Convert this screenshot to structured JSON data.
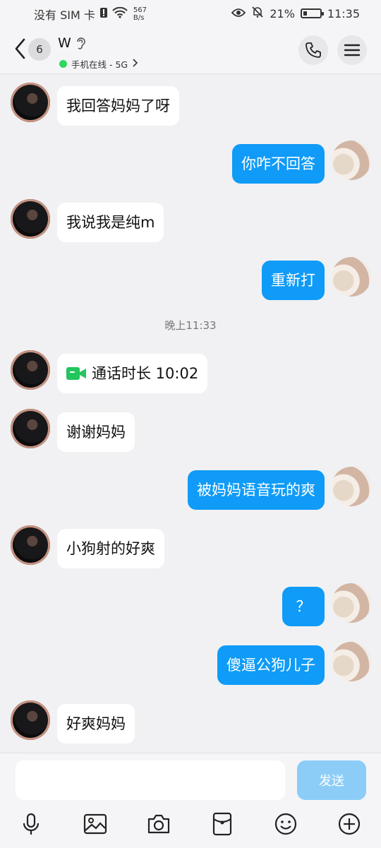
{
  "status": {
    "carrier": "没有 SIM 卡",
    "net_speed_value": "567",
    "net_speed_unit": "B/s",
    "battery": "21%",
    "battery_level": 0.21,
    "time": "11:35"
  },
  "header": {
    "unread_count": "6",
    "contact_name": "W",
    "online_status": "手机在线 - 5G",
    "icons": [
      "back-chevron-icon",
      "ear-icon",
      "phone-icon",
      "menu-icon"
    ]
  },
  "chat": {
    "messages": [
      {
        "side": "in",
        "text": "我回答妈妈了呀"
      },
      {
        "side": "out",
        "text": "你咋不回答"
      },
      {
        "side": "in",
        "text": "我说我是纯m"
      },
      {
        "side": "out",
        "text": "重新打"
      },
      {
        "side": "in",
        "text": "通话时长 10:02",
        "type": "video-call"
      },
      {
        "side": "in",
        "text": "谢谢妈妈"
      },
      {
        "side": "out",
        "text": "被妈妈语音玩的爽"
      },
      {
        "side": "in",
        "text": "小狗射的好爽"
      },
      {
        "side": "out",
        "text": "？"
      },
      {
        "side": "out",
        "text": "傻逼公狗儿子"
      },
      {
        "side": "in",
        "text": "好爽妈妈"
      }
    ],
    "timestamp": "晚上11:33"
  },
  "input": {
    "value": "",
    "send_label": "发送",
    "send_color": "#8ccdf8"
  },
  "toolbar": [
    "microphone-icon",
    "image-icon",
    "camera-icon",
    "red-packet-icon",
    "emoji-icon",
    "add-icon"
  ],
  "colors": {
    "outgoing_bubble": "#0f9bf7",
    "incoming_bubble": "#ffffff",
    "online_dot": "#2dd85b",
    "video_icon": "#22c55e"
  }
}
